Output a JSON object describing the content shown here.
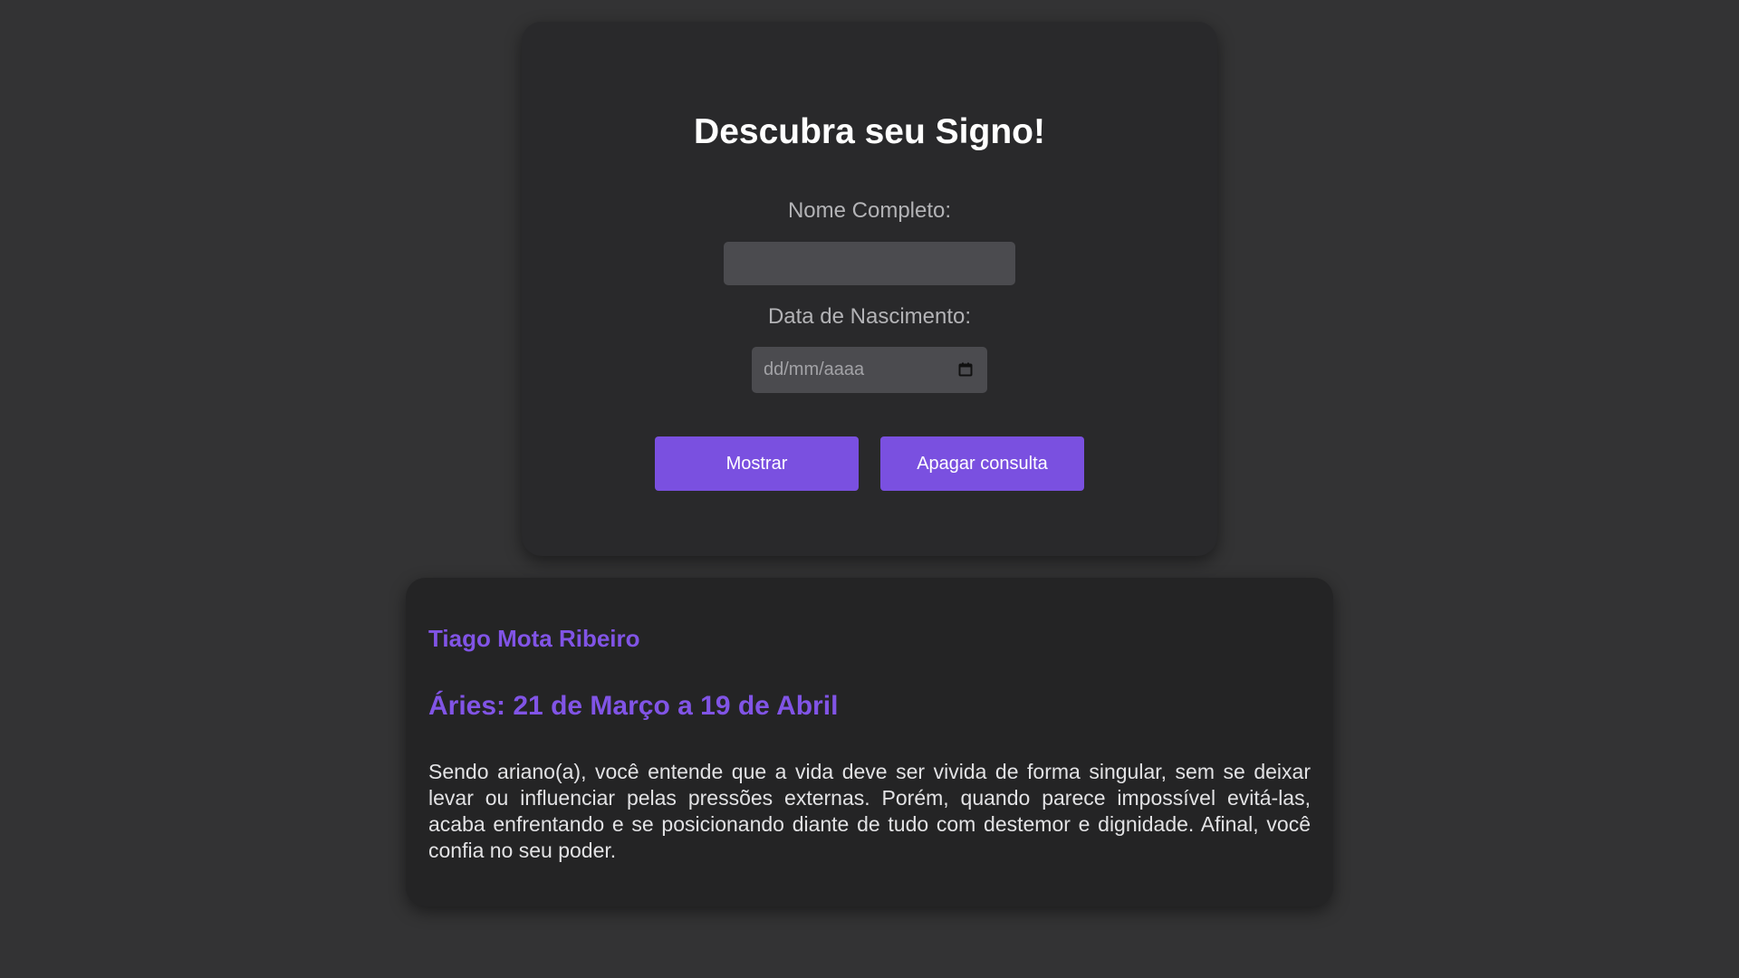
{
  "form": {
    "title": "Descubra seu Signo!",
    "name_label": "Nome Completo:",
    "name_value": "",
    "date_label": "Data de Nascimento:",
    "date_placeholder": "dd/mm/aaaa",
    "date_icon": "calendar-icon",
    "show_button": "Mostrar",
    "clear_button": "Apagar consulta"
  },
  "result": {
    "name": "Tiago Mota Ribeiro",
    "sign": "Áries: 21 de Março a 19 de Abril",
    "description": "Sendo ariano(a), você entende que a vida deve ser vivida de forma singular, sem se deixar levar ou influenciar pelas pressões externas. Porém, quando parece impossível evitá-las, acaba enfrentando e se posicionando diante de tudo com destemor e dignidade. Afinal, você confia no seu poder."
  },
  "colors": {
    "background": "#333334",
    "card": "#29292b",
    "accent": "#7a50e0",
    "input": "#4b4b4f"
  }
}
